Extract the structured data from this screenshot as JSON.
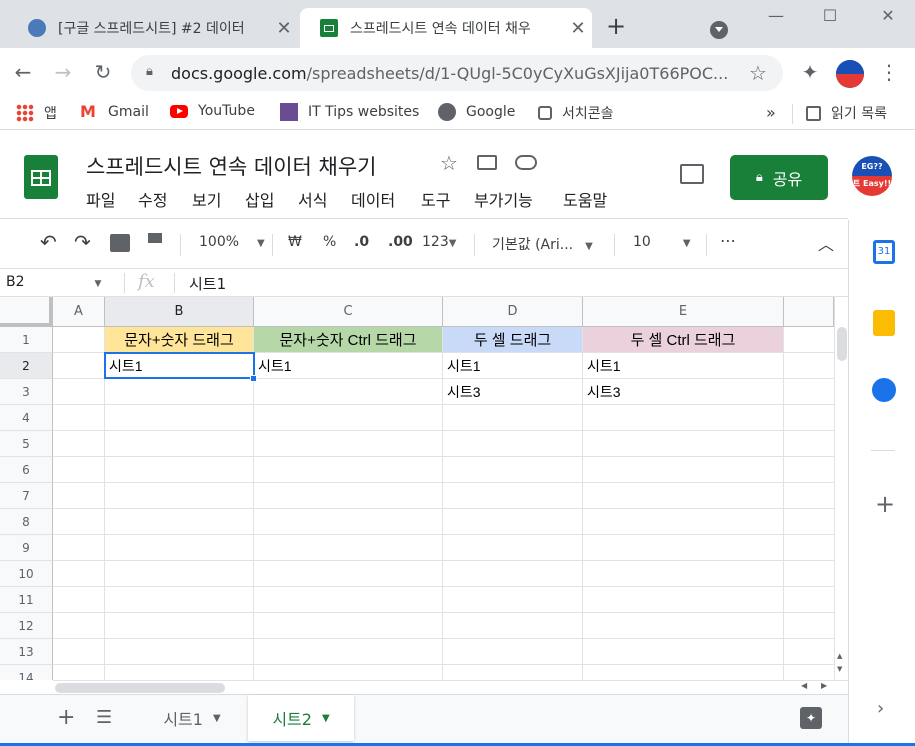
{
  "browser": {
    "tabs": [
      {
        "title": "[구글 스프레드시트] #2 데이터",
        "active": false
      },
      {
        "title": "스프레드시트 연속 데이터 채우",
        "active": true
      }
    ],
    "new_tab": "+",
    "url_host": "docs.google.com",
    "url_path": "/spreadsheets/d/1-QUgl-5C0yCyXuGsXJija0T66POC..."
  },
  "bookmarks": {
    "items": [
      {
        "label": "앱",
        "icon": "apps-grid-icon"
      },
      {
        "label": "Gmail",
        "icon": "gmail-icon"
      },
      {
        "label": "YouTube",
        "icon": "youtube-icon"
      },
      {
        "label": "IT Tips websites",
        "icon": "folder-icon"
      },
      {
        "label": "Google",
        "icon": "globe-icon"
      },
      {
        "label": "서치콘솔",
        "icon": "search-console-icon"
      }
    ],
    "more": "»",
    "reading_list": "읽기 목록"
  },
  "doc": {
    "title": "스프레드시트 연속 데이터 채우기",
    "menus": [
      "파일",
      "수정",
      "보기",
      "삽입",
      "서식",
      "데이터",
      "도구",
      "부가기능",
      "도움말"
    ],
    "share": "공유",
    "avatar_text_top": "EG??",
    "avatar_text_bottom": "트 Easy!!"
  },
  "toolbar": {
    "zoom": "100%",
    "currency": "₩",
    "percent": "%",
    "dec_decrease": ".0",
    "dec_increase": ".00",
    "number_format": "123",
    "font": "기본값 (Ari...",
    "font_size": "10",
    "more": "⋯"
  },
  "formula": {
    "cell_ref": "B2",
    "fx": "fx",
    "content": "시트1"
  },
  "grid": {
    "columns": [
      "A",
      "B",
      "C",
      "D",
      "E"
    ],
    "rows": [
      "1",
      "2",
      "3",
      "4",
      "5",
      "6",
      "7",
      "8",
      "9",
      "10",
      "11",
      "12",
      "13",
      "14"
    ],
    "header_row": {
      "B": "문자+숫자 드래그",
      "C": "문자+숫자 Ctrl 드래그",
      "D": "두 셀 드래그",
      "E": "두 셀 Ctrl 드래그"
    },
    "row2": {
      "B": "시트1",
      "C": "시트1",
      "D": "시트1",
      "E": "시트1"
    },
    "row3": {
      "D": "시트3",
      "E": "시트3"
    },
    "header_colors": {
      "B": "#ffe599",
      "C": "#b6d7a8",
      "D": "#c9daf8",
      "E": "#ead1dc"
    },
    "selected_cell": "B2"
  },
  "sheets": {
    "tabs": [
      {
        "label": "시트1",
        "active": false
      },
      {
        "label": "시트2",
        "active": true
      }
    ]
  },
  "colors": {
    "sheets_green": "#188038",
    "selection_blue": "#1a73e8"
  }
}
